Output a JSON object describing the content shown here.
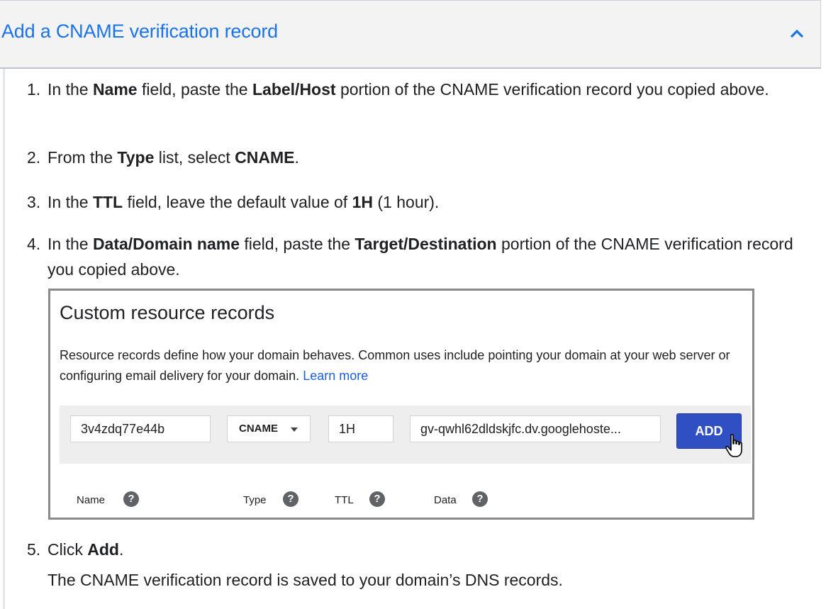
{
  "accordion": {
    "title": "Add a CNAME verification record"
  },
  "steps": [
    {
      "num": "1.",
      "parts": [
        {
          "t": "In the "
        },
        {
          "t": "Name",
          "b": true
        },
        {
          "t": " field, paste the "
        },
        {
          "t": "Label/Host",
          "b": true
        },
        {
          "t": " portion of the CNAME verification record you copied above."
        }
      ]
    },
    {
      "num": "2.",
      "parts": [
        {
          "t": "From the "
        },
        {
          "t": "Type",
          "b": true
        },
        {
          "t": " list, select "
        },
        {
          "t": "CNAME",
          "b": true
        },
        {
          "t": "."
        }
      ]
    },
    {
      "num": "3.",
      "parts": [
        {
          "t": "In the "
        },
        {
          "t": "TTL",
          "b": true
        },
        {
          "t": " field, leave the default value of "
        },
        {
          "t": "1H",
          "b": true
        },
        {
          "t": " (1 hour)."
        }
      ]
    },
    {
      "num": "4.",
      "parts": [
        {
          "t": "In the "
        },
        {
          "t": "Data/Domain name",
          "b": true
        },
        {
          "t": " field, paste the "
        },
        {
          "t": "Target/Destination",
          "b": true
        },
        {
          "t": " portion of the CNAME verification record you copied above."
        }
      ]
    },
    {
      "num": "5.",
      "parts": [
        {
          "t": "Click "
        },
        {
          "t": "Add",
          "b": true
        },
        {
          "t": "."
        }
      ],
      "note": "The CNAME verification record is saved to your domain’s DNS records."
    }
  ],
  "panel": {
    "title": "Custom resource records",
    "description": "Resource records define how your domain behaves. Common uses include pointing your domain at your web server or configuring email delivery for your domain.",
    "learn_more": "Learn more",
    "record": {
      "name": "3v4zdq77e44b",
      "type": "CNAME",
      "ttl": "1H",
      "data": "gv-qwhl62dldskjfc.dv.googlehoste...",
      "add_label": "ADD"
    },
    "labels": {
      "name": "Name",
      "type": "Type",
      "ttl": "TTL",
      "data": "Data",
      "help": "?"
    }
  },
  "colors": {
    "accent": "#1a73e8",
    "button": "#2f4fc3",
    "link": "#1a5fd8"
  },
  "icons": {
    "collapse": "chevron-up-icon",
    "dropdown": "caret-down-icon",
    "help": "help-circle-icon",
    "cursor": "hand-pointer-icon"
  }
}
